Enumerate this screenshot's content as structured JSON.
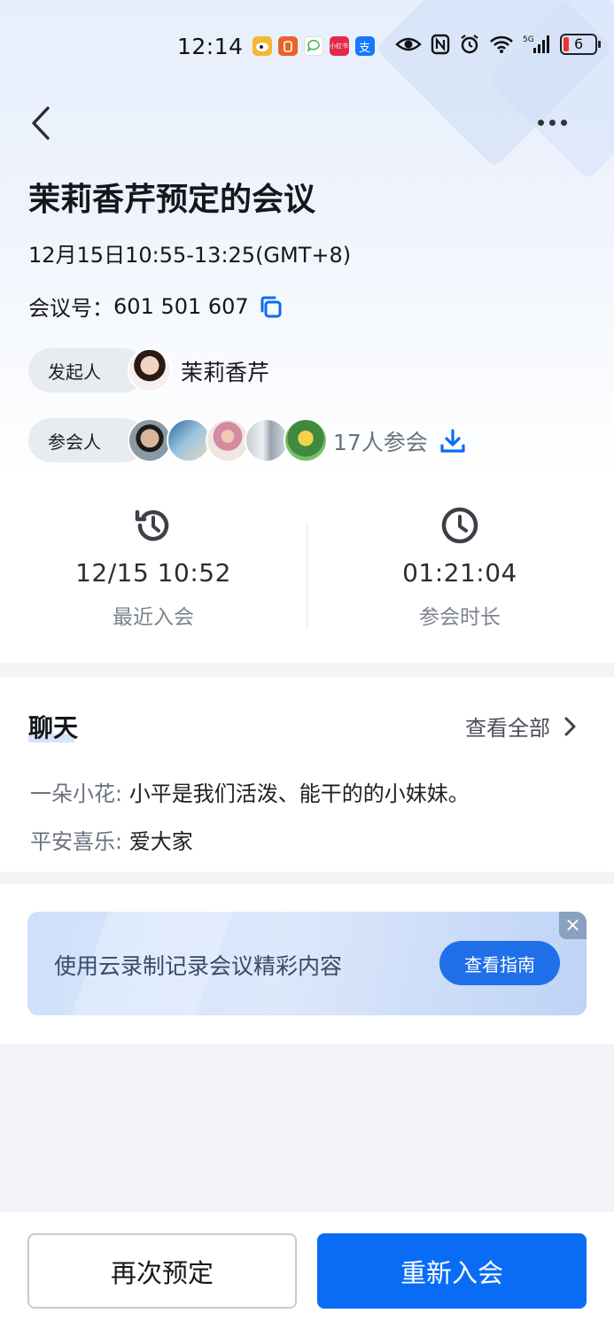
{
  "status_bar": {
    "time": "12:14",
    "apps": [
      {
        "icon": "weibo-icon",
        "color": "#f5b82e",
        "text": ""
      },
      {
        "icon": "orange-app-icon",
        "color": "#e8622a",
        "text": ""
      },
      {
        "icon": "message-icon",
        "color": "#ffffff",
        "text": ""
      },
      {
        "icon": "red-app-icon",
        "color": "#e3294a",
        "text": "小红书"
      },
      {
        "icon": "alipay-icon",
        "color": "#1677ff",
        "text": "支"
      }
    ],
    "battery_level": "6"
  },
  "header": {
    "back_icon": "chevron-left-icon",
    "more_icon": "more-horizontal-icon"
  },
  "meeting": {
    "title": "茉莉香芹预定的会议",
    "time_range": "12月15日10:55-13:25(GMT+8)",
    "id_label": "会议号：",
    "id_value": "601 501 607",
    "host_label": "发起人",
    "host_name": "茉莉香芹",
    "attendees_label": "参会人",
    "attendees_count": "17人参会"
  },
  "stats": {
    "recent_join_value": "12/15 10:52",
    "recent_join_label": "最近入会",
    "duration_value": "01:21:04",
    "duration_label": "参会时长"
  },
  "chat": {
    "title": "聊天",
    "view_all": "查看全部",
    "messages": [
      {
        "sender": "一朵小花:",
        "text": "小平是我们活泼、能干的的小妹妹。"
      },
      {
        "sender": "平安喜乐:",
        "text": "爱大家"
      }
    ]
  },
  "banner": {
    "text": "使用云录制记录会议精彩内容",
    "button": "查看指南",
    "close": "×"
  },
  "actions": {
    "rebook": "再次预定",
    "rejoin": "重新入会"
  },
  "colors": {
    "accent": "#0a6cf5",
    "banner_button": "#1f6fe8"
  }
}
